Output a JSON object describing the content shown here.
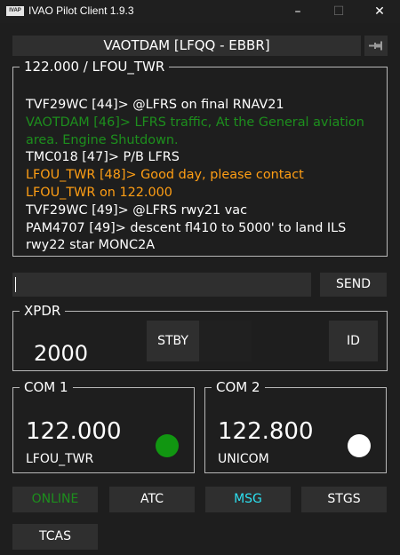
{
  "window": {
    "title": "IVAO Pilot Client 1.9.3",
    "logo_text": "IVAP",
    "minimize_glyph": "–",
    "maximize_glyph": "☐",
    "close_glyph": "✕"
  },
  "flight": {
    "callsign_route": "VAOTDAM [LFQQ - EBBR]",
    "pin_icon": "pin-icon"
  },
  "chat": {
    "channel": "122.000 / LFOU_TWR",
    "lines": [
      {
        "text": "TVF29WC [44]> @LFRS on final RNAV21",
        "color": "#ffffff"
      },
      {
        "text": "VAOTDAM [46]> LFRS traffic, At the General aviation",
        "color": "#1d8f1d"
      },
      {
        "text": "area. Engine Shutdown.",
        "color": "#1d8f1d"
      },
      {
        "text": "TMC018 [47]> P/B LFRS",
        "color": "#ffffff"
      },
      {
        "text": "LFOU_TWR [48]> Good day, please contact",
        "color": "#ff9e14"
      },
      {
        "text": "LFOU_TWR on 122.000",
        "color": "#ff9e14"
      },
      {
        "text": "TVF29WC [49]> @LFRS rwy21 vac",
        "color": "#ffffff"
      },
      {
        "text": "PAM4707 [49]> descent fl410 to 5000' to land ILS",
        "color": "#ffffff"
      },
      {
        "text": "rwy22 star MONC2A",
        "color": "#ffffff"
      }
    ],
    "input_value": "",
    "send_label": "SEND"
  },
  "xpdr": {
    "label": "XPDR",
    "code": "2000",
    "stby_label": "STBY",
    "id_label": "ID"
  },
  "com1": {
    "label": "COM 1",
    "frequency": "122.000",
    "station": "LFOU_TWR",
    "indicator_color": "#119611"
  },
  "com2": {
    "label": "COM 2",
    "frequency": "122.800",
    "station": "UNICOM",
    "indicator_color": "#ffffff"
  },
  "buttons": {
    "online": "ONLINE",
    "atc": "ATC",
    "msg": "MSG",
    "stgs": "STGS",
    "tcas": "TCAS"
  },
  "colors": {
    "background": "#1e1e1e",
    "panel": "#2f2f2f",
    "online_green": "#1d8f1d",
    "orange": "#ff9e14",
    "cyan": "#2ce0f0"
  }
}
